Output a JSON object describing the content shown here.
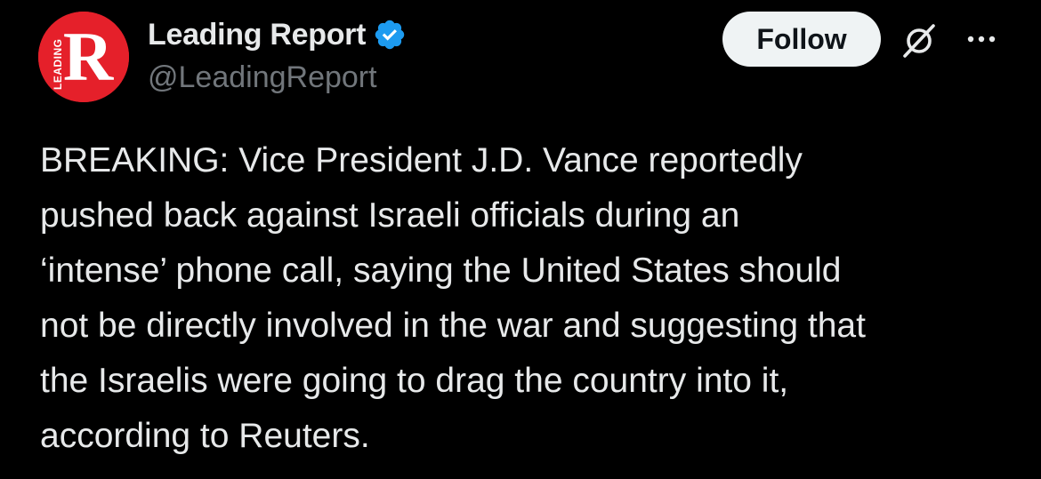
{
  "author": {
    "display_name": "Leading Report",
    "handle": "@LeadingReport",
    "avatar_letter": "R",
    "avatar_side_text": "LEADING",
    "verified": true
  },
  "actions": {
    "follow_label": "Follow",
    "grok_icon": "grok-icon",
    "more_icon": "more-icon"
  },
  "post": {
    "text": "BREAKING: Vice President J.D. Vance reportedly\npushed back against Israeli officials during an\n‘intense’ phone call, saying the United States should\nnot be directly involved in the war and suggesting that\nthe Israelis were going to drag the country into it,\naccording to Reuters."
  },
  "colors": {
    "background": "#000000",
    "text_primary": "#e7e9ea",
    "text_secondary": "#71767b",
    "verified_badge": "#1d9bf0",
    "avatar_red": "#e5202a",
    "follow_bg": "#eff3f4"
  }
}
